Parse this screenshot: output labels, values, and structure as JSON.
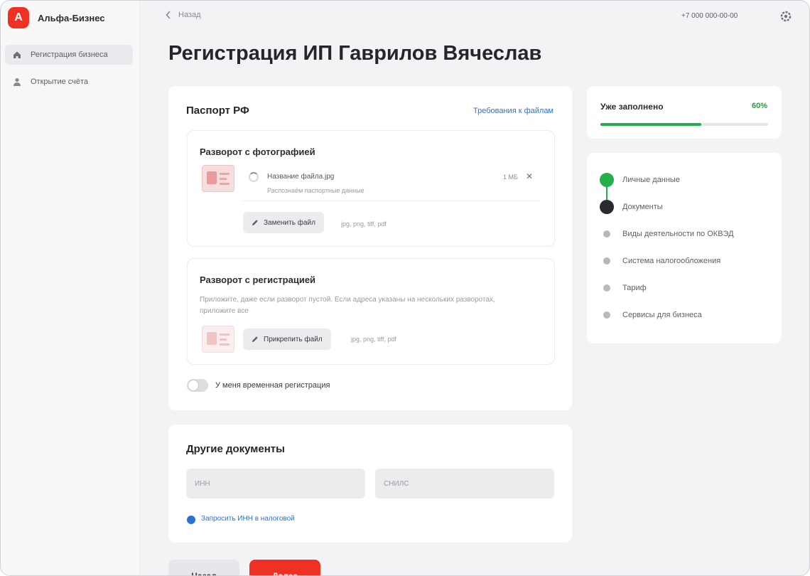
{
  "app": {
    "logo_letter": "A",
    "name": "Альфа-Бизнес",
    "accent_color": "#ef3124"
  },
  "sidebar": {
    "items": [
      {
        "label": "Регистрация бизнеса",
        "icon": "home-icon",
        "active": true
      },
      {
        "label": "Открытие счёта",
        "icon": "user-icon",
        "active": false
      }
    ]
  },
  "header": {
    "back_label": "Назад",
    "phone": "+7 000 000-00-00",
    "settings_icon": "gear-icon"
  },
  "page": {
    "title": "Регистрация ИП Гаврилов Вячеслав"
  },
  "passport": {
    "title": "Паспорт РФ",
    "link": "Требования к файлам",
    "photo_spread": {
      "title": "Разворот с фотографией",
      "file_name": "Название файла.jpg",
      "file_status": "Распознаём паспортные данные",
      "file_size": "1 МБ",
      "replace_button": "Заменить файл",
      "formats": "jpg, png, tiff, pdf"
    },
    "registration_spread": {
      "title": "Разворот с регистрацией",
      "description": "Приложите, даже если разворот пустой. Если адреса указаны на нескольких разворотах, приложите все",
      "upload_button": "Прикрепить файл",
      "formats": "jpg, png, tiff, pdf"
    },
    "temp_registration_toggle": {
      "label": "У меня временная регистрация",
      "checked": false
    }
  },
  "other_docs": {
    "title": "Другие документы",
    "inn_placeholder": "ИНН",
    "snils_placeholder": "СНИЛС",
    "checkbox_label": "Запросить ИНН в налоговой",
    "checkbox_checked": true
  },
  "progress": {
    "label": "Уже заполнено",
    "value_text": "60%",
    "value": 0.6,
    "color": "#21b04b"
  },
  "steps": [
    {
      "label": "Личные данные",
      "state": "done"
    },
    {
      "label": "Документы",
      "state": "current"
    },
    {
      "label": "Виды деятельности по ОКВЭД",
      "state": "todo"
    },
    {
      "label": "Система налогообложения",
      "state": "todo"
    },
    {
      "label": "Тариф",
      "state": "todo"
    },
    {
      "label": "Сервисы для бизнеса",
      "state": "todo"
    }
  ],
  "footer": {
    "back_button": "Назад",
    "next_button": "Далее"
  }
}
